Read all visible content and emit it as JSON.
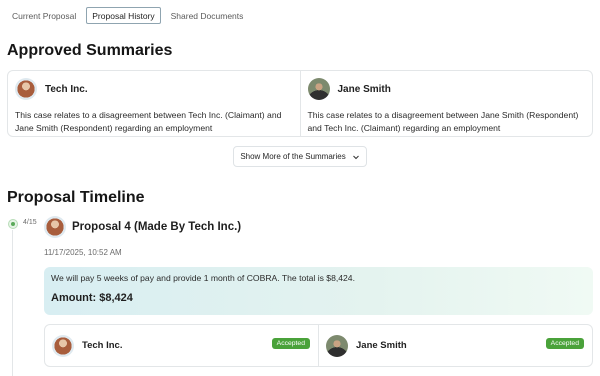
{
  "tabs": [
    {
      "label": "Current Proposal",
      "active": false
    },
    {
      "label": "Proposal History",
      "active": true
    },
    {
      "label": "Shared Documents",
      "active": false
    }
  ],
  "approved_summaries": {
    "title": "Approved Summaries",
    "items": [
      {
        "name": "Tech Inc.",
        "avatar": "woman-avatar",
        "text": "This case relates to a disagreement between Tech Inc. (Claimant) and Jane Smith (Respondent) regarding an employment"
      },
      {
        "name": "Jane Smith",
        "avatar": "man-avatar",
        "text": "This case relates to a disagreement between Jane Smith (Respondent) and Tech Inc. (Claimant) regarding an employment"
      }
    ],
    "show_more_label": "Show More of the Summaries"
  },
  "timeline": {
    "title": "Proposal Timeline",
    "step": "4/15",
    "proposal_title": "Proposal 4 (Made By Tech Inc.)",
    "timestamp": "11/17/2025, 10:52 AM",
    "description": "We will pay 5 weeks of pay and provide 1 month of COBRA. The total is $8,424.",
    "amount": "Amount: $8,424",
    "responses": [
      {
        "name": "Tech Inc.",
        "status": "Accepted"
      },
      {
        "name": "Jane Smith",
        "status": "Accepted"
      }
    ]
  },
  "colors": {
    "accent_green": "#4aa23a",
    "card_gradient_start": "#d8eef2"
  }
}
